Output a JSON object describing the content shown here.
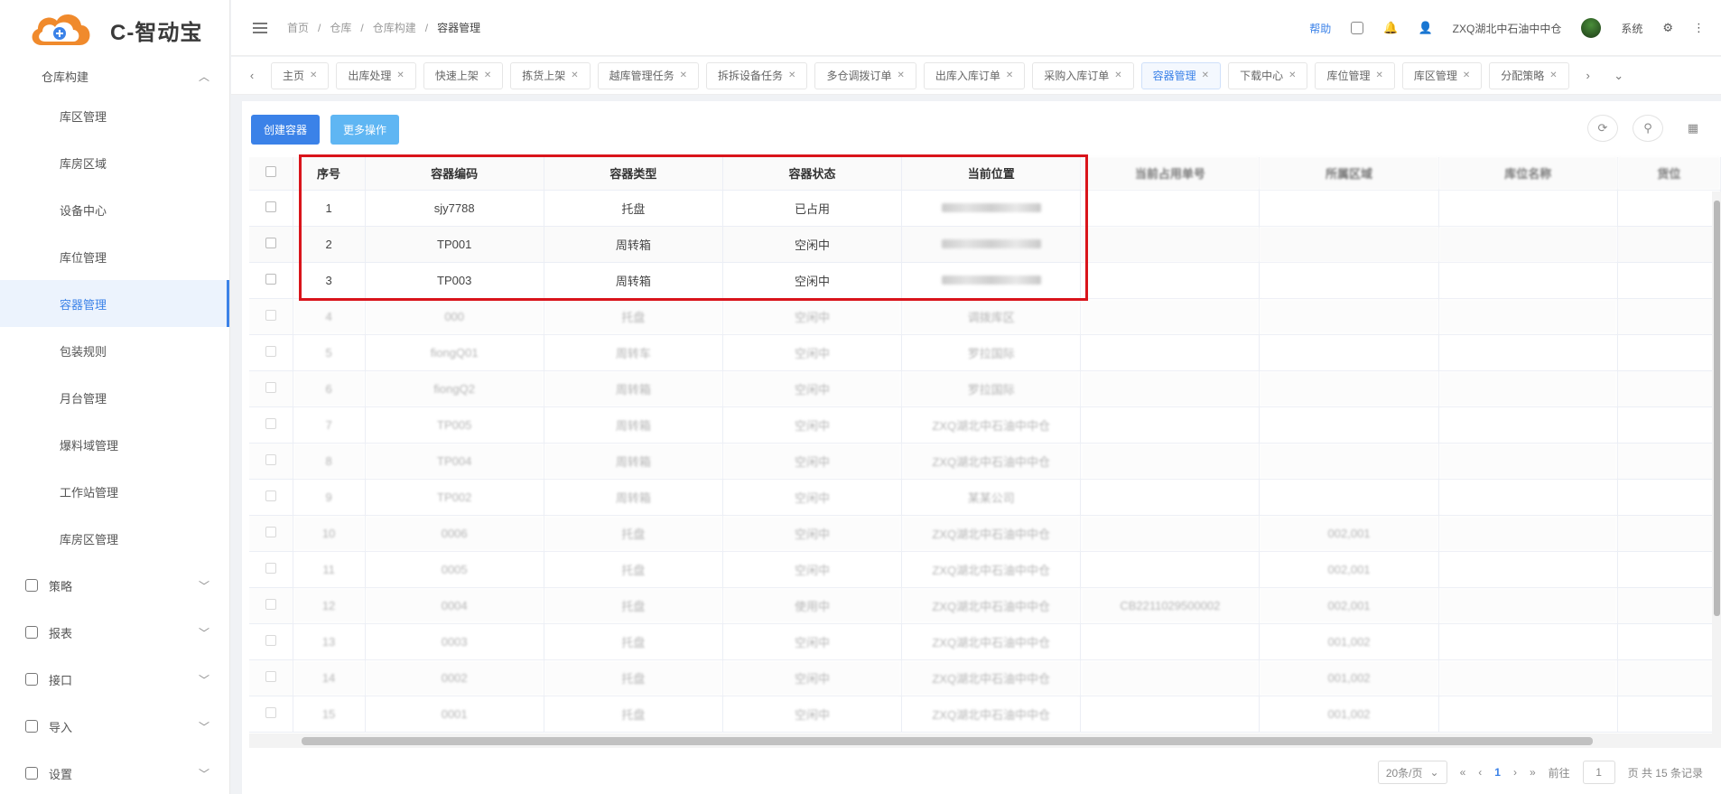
{
  "logo": {
    "text": "C-智动宝"
  },
  "sidebar": {
    "group_label": "仓库构建",
    "items": [
      {
        "label": "库区管理"
      },
      {
        "label": "库房区域"
      },
      {
        "label": "设备中心"
      },
      {
        "label": "库位管理"
      },
      {
        "label": "容器管理",
        "active": true
      },
      {
        "label": "包装规则"
      },
      {
        "label": "月台管理"
      },
      {
        "label": "爆料域管理"
      },
      {
        "label": "工作站管理"
      },
      {
        "label": "库房区管理"
      }
    ],
    "sections": [
      {
        "label": "策略"
      },
      {
        "label": "报表"
      },
      {
        "label": "接口"
      },
      {
        "label": "导入"
      },
      {
        "label": "设置"
      }
    ]
  },
  "header": {
    "breadcrumb": [
      "首页",
      "仓库",
      "仓库构建",
      "容器管理"
    ],
    "help_link": "帮助",
    "user_name": "ZXQ湖北中石油中中仓",
    "user_role": "系统"
  },
  "tabs": [
    {
      "label": "主页"
    },
    {
      "label": "出库处理"
    },
    {
      "label": "快速上架"
    },
    {
      "label": "拣货上架"
    },
    {
      "label": "越库管理任务"
    },
    {
      "label": "拆拆设备任务"
    },
    {
      "label": "多仓调拨订单"
    },
    {
      "label": "出库入库订单"
    },
    {
      "label": "采购入库订单"
    },
    {
      "label": "容器管理",
      "active": true
    },
    {
      "label": "下载中心"
    },
    {
      "label": "库位管理"
    },
    {
      "label": "库区管理"
    },
    {
      "label": "分配策略"
    }
  ],
  "toolbar": {
    "create_label": "创建容器",
    "more_label": "更多操作"
  },
  "table": {
    "columns": [
      "序号",
      "容器编码",
      "容器类型",
      "容器状态",
      "当前位置",
      "当前占用单号",
      "所属区域",
      "库位名称",
      "货位"
    ],
    "rows": [
      {
        "no": "1",
        "code": "sjy7788",
        "type": "托盘",
        "status": "已占用",
        "loc": "",
        "order": "",
        "area": "",
        "bin": ""
      },
      {
        "no": "2",
        "code": "TP001",
        "type": "周转箱",
        "status": "空闲中",
        "loc": "",
        "order": "",
        "area": "",
        "bin": ""
      },
      {
        "no": "3",
        "code": "TP003",
        "type": "周转箱",
        "status": "空闲中",
        "loc": "",
        "order": "",
        "area": "",
        "bin": ""
      },
      {
        "no": "4",
        "code": "000",
        "type": "托盘",
        "status": "空闲中",
        "loc": "调拨库区",
        "order": "",
        "area": "",
        "bin": ""
      },
      {
        "no": "5",
        "code": "fiongQ01",
        "type": "周转车",
        "status": "空闲中",
        "loc": "罗拉国际",
        "order": "",
        "area": "",
        "bin": ""
      },
      {
        "no": "6",
        "code": "fiongQ2",
        "type": "周转箱",
        "status": "空闲中",
        "loc": "罗拉国际",
        "order": "",
        "area": "",
        "bin": ""
      },
      {
        "no": "7",
        "code": "TP005",
        "type": "周转箱",
        "status": "空闲中",
        "loc": "ZXQ湖北中石油中中仓",
        "order": "",
        "area": "",
        "bin": ""
      },
      {
        "no": "8",
        "code": "TP004",
        "type": "周转箱",
        "status": "空闲中",
        "loc": "ZXQ湖北中石油中中仓",
        "order": "",
        "area": "",
        "bin": ""
      },
      {
        "no": "9",
        "code": "TP002",
        "type": "周转箱",
        "status": "空闲中",
        "loc": "某某公司",
        "order": "",
        "area": "",
        "bin": ""
      },
      {
        "no": "10",
        "code": "0006",
        "type": "托盘",
        "status": "空闲中",
        "loc": "ZXQ湖北中石油中中仓",
        "order": "",
        "area": "002,001",
        "bin": ""
      },
      {
        "no": "11",
        "code": "0005",
        "type": "托盘",
        "status": "空闲中",
        "loc": "ZXQ湖北中石油中中仓",
        "order": "",
        "area": "002,001",
        "bin": ""
      },
      {
        "no": "12",
        "code": "0004",
        "type": "托盘",
        "status": "使用中",
        "loc": "ZXQ湖北中石油中中仓",
        "order": "CB2211029500002",
        "area": "002,001",
        "bin": ""
      },
      {
        "no": "13",
        "code": "0003",
        "type": "托盘",
        "status": "空闲中",
        "loc": "ZXQ湖北中石油中中仓",
        "order": "",
        "area": "001,002",
        "bin": ""
      },
      {
        "no": "14",
        "code": "0002",
        "type": "托盘",
        "status": "空闲中",
        "loc": "ZXQ湖北中石油中中仓",
        "order": "",
        "area": "001,002",
        "bin": ""
      },
      {
        "no": "15",
        "code": "0001",
        "type": "托盘",
        "status": "空闲中",
        "loc": "ZXQ湖北中石油中中仓",
        "order": "",
        "area": "001,002",
        "bin": ""
      }
    ]
  },
  "pager": {
    "page_size": "20条/页",
    "current_page": "1",
    "goto_label": "前往",
    "goto_value": "1",
    "total": "页 共 15 条记录"
  },
  "colors": {
    "primary": "#3b82e8",
    "highlight_border": "#d9141b"
  }
}
